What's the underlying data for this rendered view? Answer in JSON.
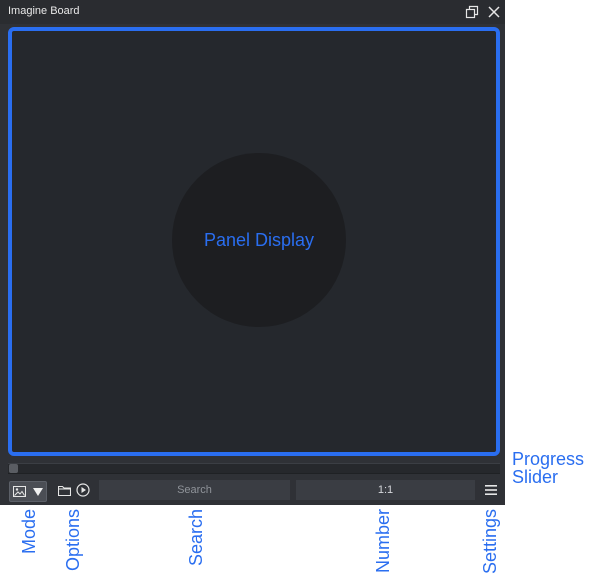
{
  "window": {
    "title": "Imagine Board"
  },
  "panel": {
    "label": "Panel Display"
  },
  "slider": {
    "progress": 0
  },
  "toolbar": {
    "search_placeholder": "Search",
    "number_value": "1:1"
  },
  "annotations": {
    "progress_slider_line1": "Progress",
    "progress_slider_line2": "Slider",
    "mode": "Mode",
    "options": "Options",
    "search": "Search",
    "number": "Number",
    "settings": "Settings"
  },
  "colors": {
    "accent": "#2a6ef0",
    "window_bg": "#2f3136",
    "panel_bg": "#25282d",
    "circle_bg": "#1d1e21"
  }
}
